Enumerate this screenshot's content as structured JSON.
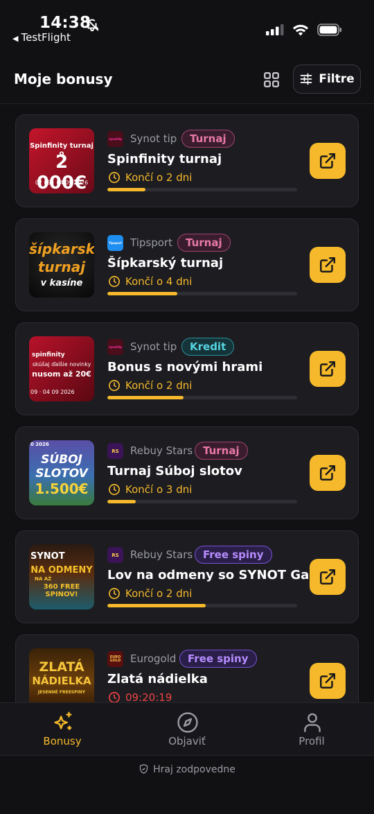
{
  "status_bar": {
    "time": "14:38",
    "back_app": "TestFlight"
  },
  "header": {
    "title": "Moje bonusy",
    "filter_label": "Filtre"
  },
  "colors": {
    "accent": "#f6b92b",
    "background": "#111114",
    "card": "#1c1c21",
    "danger": "#ef4444"
  },
  "bonuses": [
    {
      "provider": "Synot tip",
      "provider_logo_text": "synottip",
      "tag": "Turnaj",
      "title": "Spinfinity turnaj",
      "ends": "Končí o 2 dni",
      "progress": 0.2,
      "thumb_line1": "Spinfinity turnaj o",
      "thumb_line2": "2 000€",
      "thumb_line3": "02 09 · 04 09 2026",
      "open_icon": "external-link-icon"
    },
    {
      "provider": "Tipsport",
      "provider_logo_text": "Tipsport",
      "tag": "Turnaj",
      "title": "Šípkarský turnaj",
      "ends": "Končí o 4 dni",
      "progress": 0.37,
      "thumb_line1": "šípkarský",
      "thumb_line2": "turnaj",
      "thumb_line3": "v kasíne",
      "open_icon": "external-link-icon"
    },
    {
      "provider": "Synot tip",
      "provider_logo_text": "synottip",
      "tag": "Kredit",
      "title": "Bonus s novými hrami",
      "ends": "Končí o 2 dni",
      "progress": 0.4,
      "thumb_line1": "spinfinity",
      "thumb_line2": "skúšaj ďalšie novinky",
      "thumb_line3": "nusom až 20€",
      "thumb_line4": "09 · 04 09 2026",
      "open_icon": "external-link-icon"
    },
    {
      "provider": "Rebuy Stars",
      "provider_logo_text": "RS",
      "tag": "Turnaj",
      "title": "Turnaj Súboj slotov",
      "ends": "Končí o 3 dni",
      "progress": 0.15,
      "thumb_line1": "SÚBOJ",
      "thumb_line2": "SLOTOV",
      "thumb_line3": "1.500€",
      "thumb_line4": "0 2026",
      "open_icon": "external-link-icon"
    },
    {
      "provider": "Rebuy Stars",
      "provider_logo_text": "RS",
      "tag": "Free spiny",
      "title": "Lov na odmeny so SYNOT Ga...",
      "ends": "Končí o 2 dni",
      "progress": 0.52,
      "thumb_line1": "SYNOT",
      "thumb_line2": "NA ODMENY",
      "thumb_line3": "360 FREE SPINOV!",
      "thumb_line4": "NA AŽ",
      "open_icon": "external-link-icon"
    },
    {
      "provider": "Eurogold",
      "provider_logo_text": "EURO GOLD",
      "tag": "Free spiny",
      "title": "Zlatá nádielka",
      "ends": "09:20:19",
      "progress": 0,
      "thumb_line1": "ZLATÁ",
      "thumb_line2": "NÁDIELKA",
      "thumb_line3": "JESENNÉ FREESPINY",
      "open_icon": "external-link-icon"
    }
  ],
  "bottom_nav": {
    "items": [
      {
        "label": "Bonusy",
        "icon": "sparkles-icon",
        "active": true
      },
      {
        "label": "Objaviť",
        "icon": "compass-icon",
        "active": false
      },
      {
        "label": "Profil",
        "icon": "user-icon",
        "active": false
      }
    ]
  },
  "footer": {
    "text": "Hraj zodpovedne",
    "icon": "shield-icon"
  }
}
